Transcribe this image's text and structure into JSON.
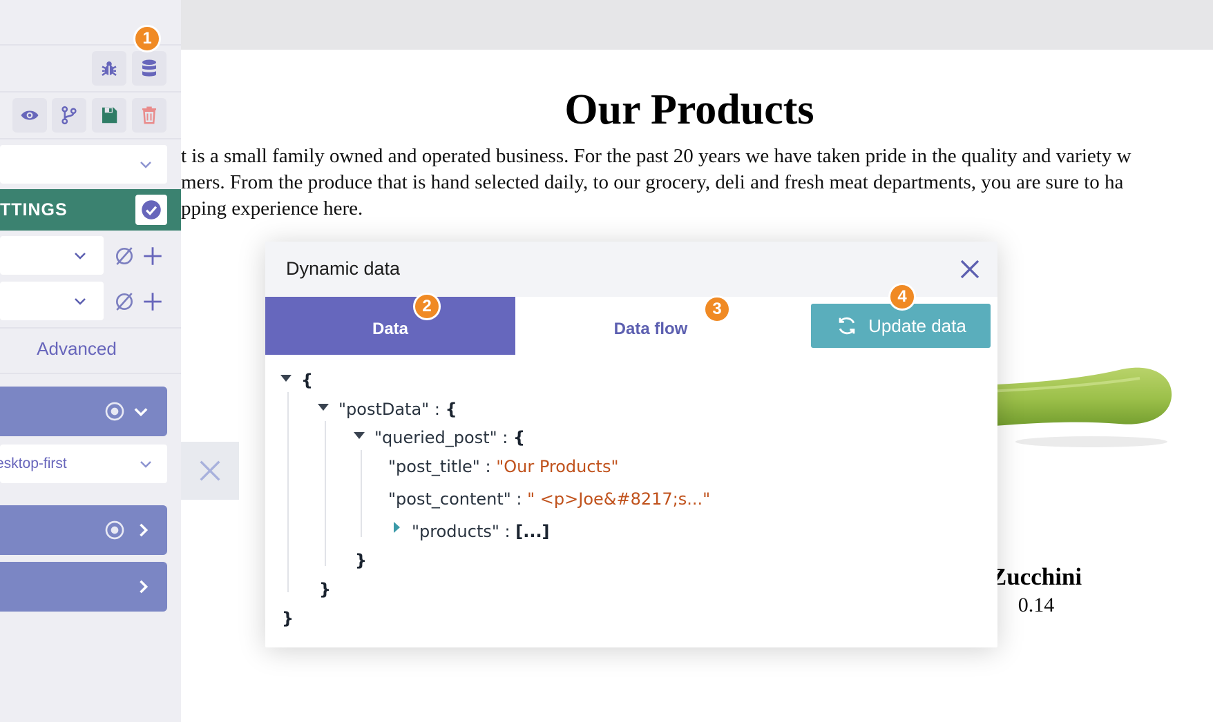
{
  "page": {
    "title": "Our Products",
    "intro_lines": [
      "t is a small family owned and operated business. For the past 20 years we have taken pride in the quality and variety w",
      "mers. From the produce that is hand selected daily, to our grocery, deli and fresh meat departments, you are sure to ha",
      "pping experience here."
    ],
    "product": {
      "name": "Zucchini",
      "price": "0.14"
    }
  },
  "sidebar": {
    "toolbar_top": [
      {
        "icon": "bug-icon"
      },
      {
        "icon": "database-icon",
        "badge": "1"
      }
    ],
    "toolbar_actions": [
      {
        "icon": "eye-icon"
      },
      {
        "icon": "branch-icon"
      },
      {
        "icon": "save-icon"
      },
      {
        "icon": "trash-icon"
      }
    ],
    "settings_label": "TTINGS",
    "advanced_label": "Advanced",
    "breakpoint_value": "esktop-first"
  },
  "modal": {
    "title": "Dynamic data",
    "tabs": [
      {
        "label": "Data",
        "badge": "2",
        "active": true
      },
      {
        "label": "Data flow",
        "badge": "3",
        "active": false
      }
    ],
    "update_button": {
      "label": "Update data",
      "badge": "4"
    },
    "tree": {
      "open_root": "{",
      "postData_key": "\"postData\"",
      "queried_post_key": "\"queried_post\"",
      "post_title_key": "\"post_title\"",
      "post_title_value": "\"Our Products\"",
      "post_content_key": "\"post_content\"",
      "post_content_value": "\" <p>Joe&#8217;s...\"",
      "products_key": "\"products\"",
      "products_value": "[...]",
      "colon": " : ",
      "open_brace": "{",
      "close_brace": "}"
    }
  },
  "colors": {
    "accent": "#6667bd",
    "settings_bar": "#3b8270",
    "update_button": "#5aaebc",
    "badge": "#f08a24",
    "string_value": "#c0521c"
  }
}
